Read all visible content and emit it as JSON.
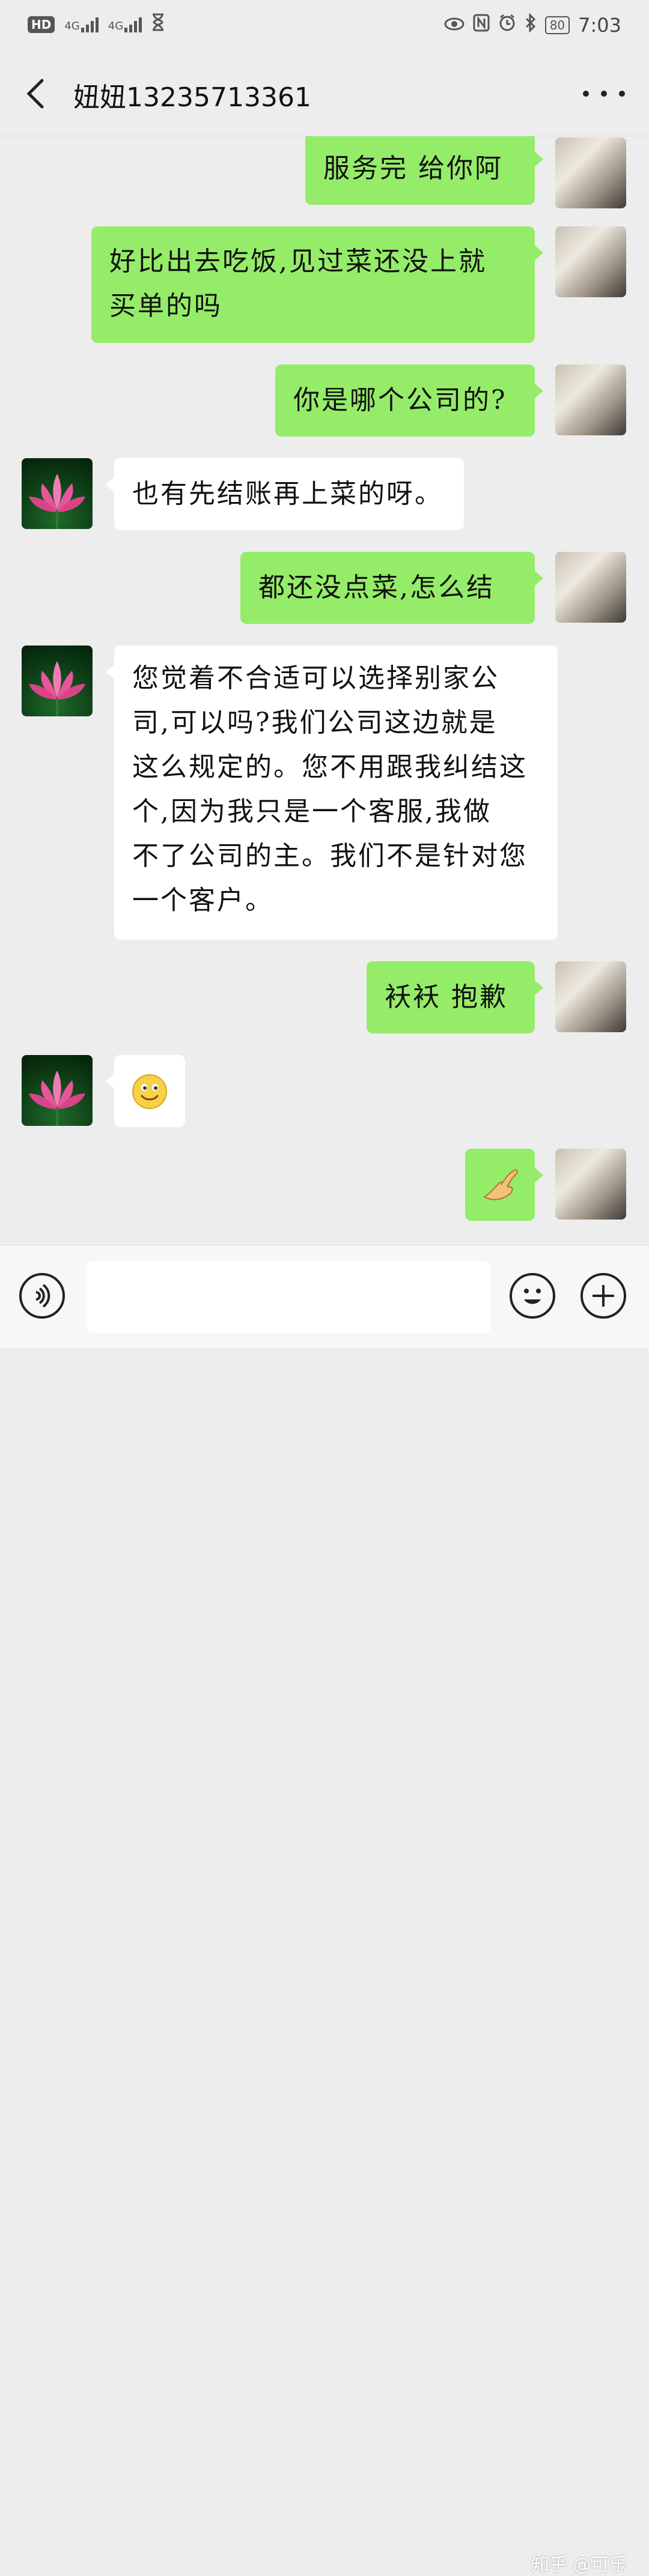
{
  "status_bar": {
    "hd_label": "HD",
    "net1": "4G",
    "net2": "4G",
    "battery": "80",
    "time": "7:03"
  },
  "header": {
    "title": "妞妞13235713361"
  },
  "messages": [
    {
      "sender": "me",
      "text": "服务完 给你阿"
    },
    {
      "sender": "me",
      "line1": "好比出去吃饭,见过菜还没上就",
      "line2": "买单的吗"
    },
    {
      "sender": "me",
      "text": "你是哪个公司的?"
    },
    {
      "sender": "other",
      "text": "也有先结账再上菜的呀。"
    },
    {
      "sender": "me",
      "text": "都还没点菜,怎么结"
    },
    {
      "sender": "other",
      "lines": [
        "您觉着不合适可以选择别家公",
        "司,可以吗?我们公司这边就是",
        "这么规定的。您不用跟我纠结这",
        "个,因为我只是一个客服,我做",
        "不了公司的主。我们不是针对您",
        "一个客户。"
      ]
    },
    {
      "sender": "me",
      "text": "袄袄 抱歉"
    },
    {
      "sender": "other",
      "emoji": "smile-emoji"
    },
    {
      "sender": "me",
      "emoji": "ok-hand-emoji"
    }
  ],
  "input_bar": {
    "placeholder": "",
    "watermark": "知乎 @可乐"
  },
  "colors": {
    "background": "#ededed",
    "my_bubble": "#95ec69",
    "their_bubble": "#ffffff"
  }
}
